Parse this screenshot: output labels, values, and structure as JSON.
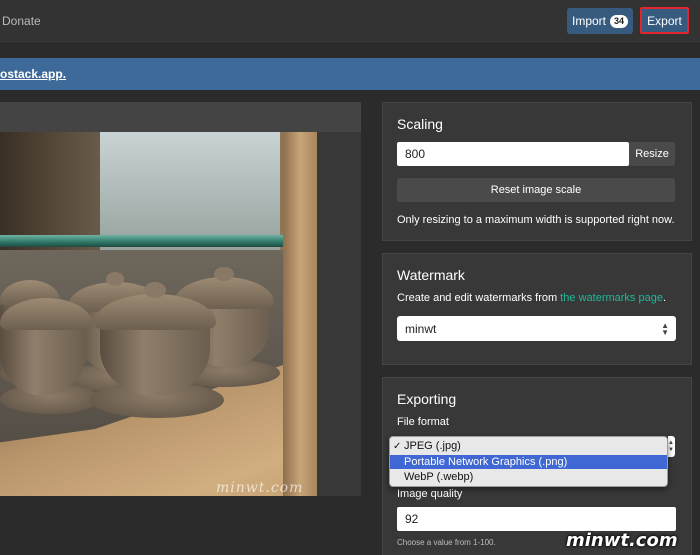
{
  "nav": {
    "donate_label": "Donate",
    "import_label": "Import",
    "import_count": "34",
    "export_label": "Export"
  },
  "alert": {
    "link_text": "ostack.app",
    "suffix": "."
  },
  "preview": {
    "watermark_overlay": "minwt.com"
  },
  "scaling": {
    "title": "Scaling",
    "width_value": "800",
    "resize_label": "Resize",
    "reset_label": "Reset image scale",
    "help": "Only resizing to a maximum width is supported right now."
  },
  "watermark": {
    "title": "Watermark",
    "help_prefix": "Create and edit watermarks from ",
    "help_link": "the watermarks page",
    "help_suffix": ".",
    "selected": "minwt"
  },
  "exporting": {
    "title": "Exporting",
    "format_label": "File format",
    "format_options": [
      {
        "label": "JPEG (.jpg)",
        "checked": true,
        "highlighted": false
      },
      {
        "label": "Portable Network Graphics (.png)",
        "checked": false,
        "highlighted": true
      },
      {
        "label": "WebP (.webp)",
        "checked": false,
        "highlighted": false
      }
    ],
    "quality_label": "Image quality",
    "quality_value": "92",
    "quality_help": "Choose a value from 1-100."
  },
  "colors": {
    "accent": "#375a7f",
    "export_outline": "#e2262b",
    "link": "#1fb89a",
    "highlight": "#3f68d5"
  },
  "site_logo": "minwt.com"
}
